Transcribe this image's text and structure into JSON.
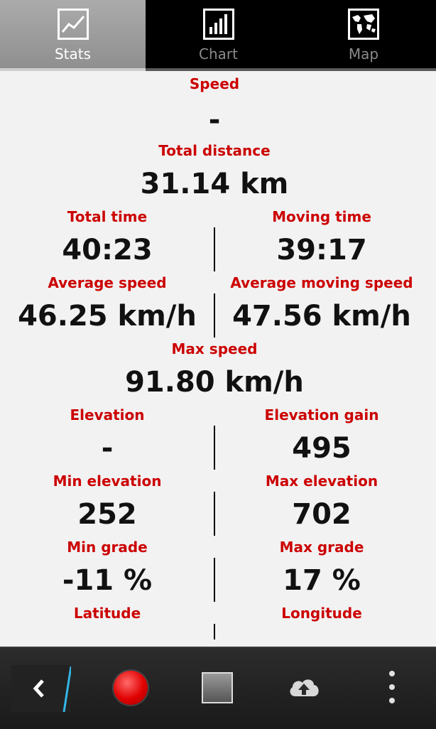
{
  "tabs": [
    {
      "label": "Stats",
      "icon": "stats-line-icon",
      "active": true
    },
    {
      "label": "Chart",
      "icon": "bar-chart-icon",
      "active": false
    },
    {
      "label": "Map",
      "icon": "world-map-icon",
      "active": false
    }
  ],
  "stats": {
    "speed_label": "Speed",
    "speed_value": "-",
    "distance_label": "Total distance",
    "distance_value": "31.14 km",
    "total_time_label": "Total time",
    "total_time_value": "40:23",
    "moving_time_label": "Moving time",
    "moving_time_value": "39:17",
    "avg_speed_label": "Average speed",
    "avg_speed_value": "46.25 km/h",
    "avg_moving_speed_label": "Average moving speed",
    "avg_moving_speed_value": "47.56 km/h",
    "max_speed_label": "Max speed",
    "max_speed_value": "91.80 km/h",
    "elevation_label": "Elevation",
    "elevation_value": "-",
    "elevation_gain_label": "Elevation gain",
    "elevation_gain_value": "495",
    "min_elevation_label": "Min elevation",
    "min_elevation_value": "252",
    "max_elevation_label": "Max elevation",
    "max_elevation_value": "702",
    "min_grade_label": "Min grade",
    "min_grade_value": "-11 %",
    "max_grade_label": "Max grade",
    "max_grade_value": "17 %",
    "latitude_label": "Latitude",
    "longitude_label": "Longitude"
  },
  "bottombar": {
    "back_icon": "chevron-left-icon",
    "record_icon": "record-icon",
    "stop_icon": "stop-icon",
    "upload_icon": "cloud-upload-icon",
    "menu_icon": "overflow-menu-icon"
  },
  "colors": {
    "label": "#cc0000",
    "value": "#111111",
    "background": "#f2f2f2",
    "record": "#e00000"
  }
}
